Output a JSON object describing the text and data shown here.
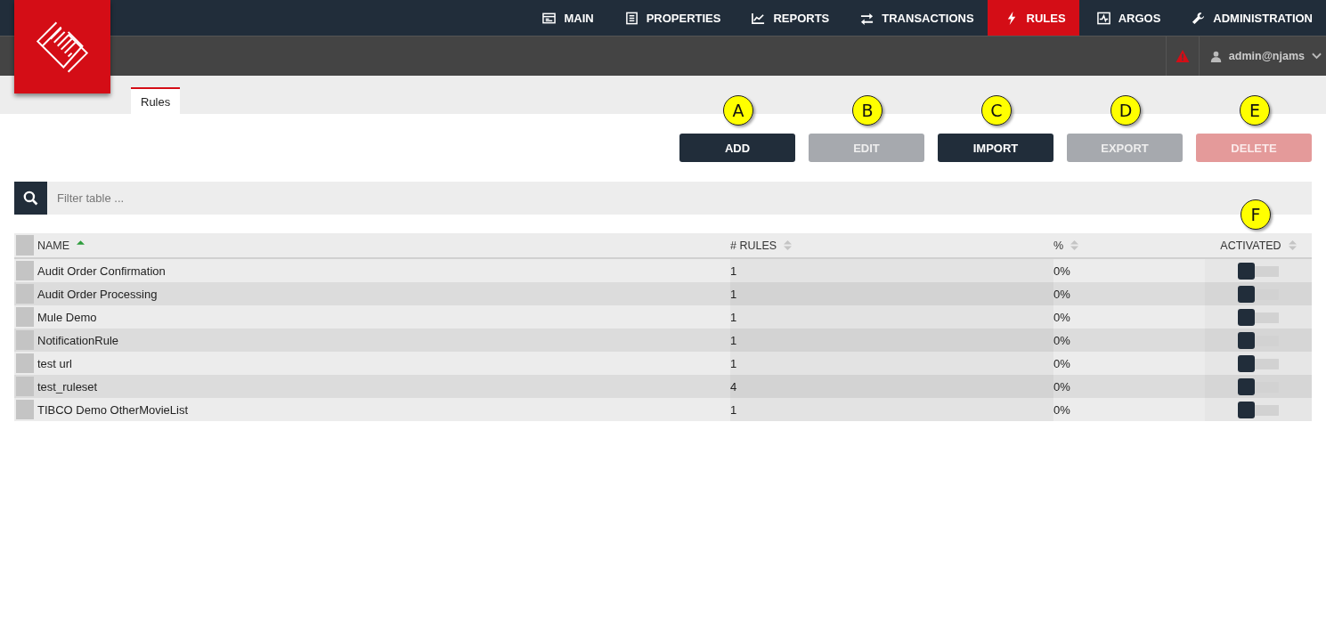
{
  "nav": [
    {
      "label": "MAIN",
      "selected": false
    },
    {
      "label": "PROPERTIES",
      "selected": false
    },
    {
      "label": "REPORTS",
      "selected": false
    },
    {
      "label": "TRANSACTIONS",
      "selected": false
    },
    {
      "label": "RULES",
      "selected": true
    },
    {
      "label": "ARGOS",
      "selected": false
    },
    {
      "label": "ADMINISTRATION",
      "selected": false
    }
  ],
  "user": {
    "name": "admin@njams"
  },
  "tabs": [
    {
      "label": "Rules",
      "selected": true
    }
  ],
  "buttons": [
    {
      "label": "ADD",
      "kind": "primary",
      "disabled": false,
      "callout": "A"
    },
    {
      "label": "EDIT",
      "kind": "primary",
      "disabled": true,
      "callout": "B"
    },
    {
      "label": "IMPORT",
      "kind": "primary",
      "disabled": false,
      "callout": "C"
    },
    {
      "label": "EXPORT",
      "kind": "primary",
      "disabled": true,
      "callout": "D"
    },
    {
      "label": "DELETE",
      "kind": "danger",
      "disabled": true,
      "callout": "E"
    }
  ],
  "filter": {
    "placeholder": "Filter table ..."
  },
  "table": {
    "all_checked": false,
    "columns": [
      {
        "label": "NAME",
        "sorted": true
      },
      {
        "label": "# RULES",
        "sorted": false
      },
      {
        "label": "%",
        "sorted": false
      },
      {
        "label": "ACTIVATED",
        "sorted": false,
        "callout": "F"
      }
    ],
    "rows": [
      {
        "checked": false,
        "name": "Audit Order Confirmation",
        "rules": "1",
        "percent": "0%",
        "activated": false
      },
      {
        "checked": false,
        "name": "Audit Order Processing",
        "rules": "1",
        "percent": "0%",
        "activated": false
      },
      {
        "checked": false,
        "name": "Mule Demo",
        "rules": "1",
        "percent": "0%",
        "activated": false
      },
      {
        "checked": false,
        "name": "NotificationRule",
        "rules": "1",
        "percent": "0%",
        "activated": false
      },
      {
        "checked": false,
        "name": "test url",
        "rules": "1",
        "percent": "0%",
        "activated": false
      },
      {
        "checked": false,
        "name": "test_ruleset",
        "rules": "4",
        "percent": "0%",
        "activated": false
      },
      {
        "checked": false,
        "name": "TIBCO Demo OtherMovieList",
        "rules": "1",
        "percent": "0%",
        "activated": false
      }
    ]
  }
}
